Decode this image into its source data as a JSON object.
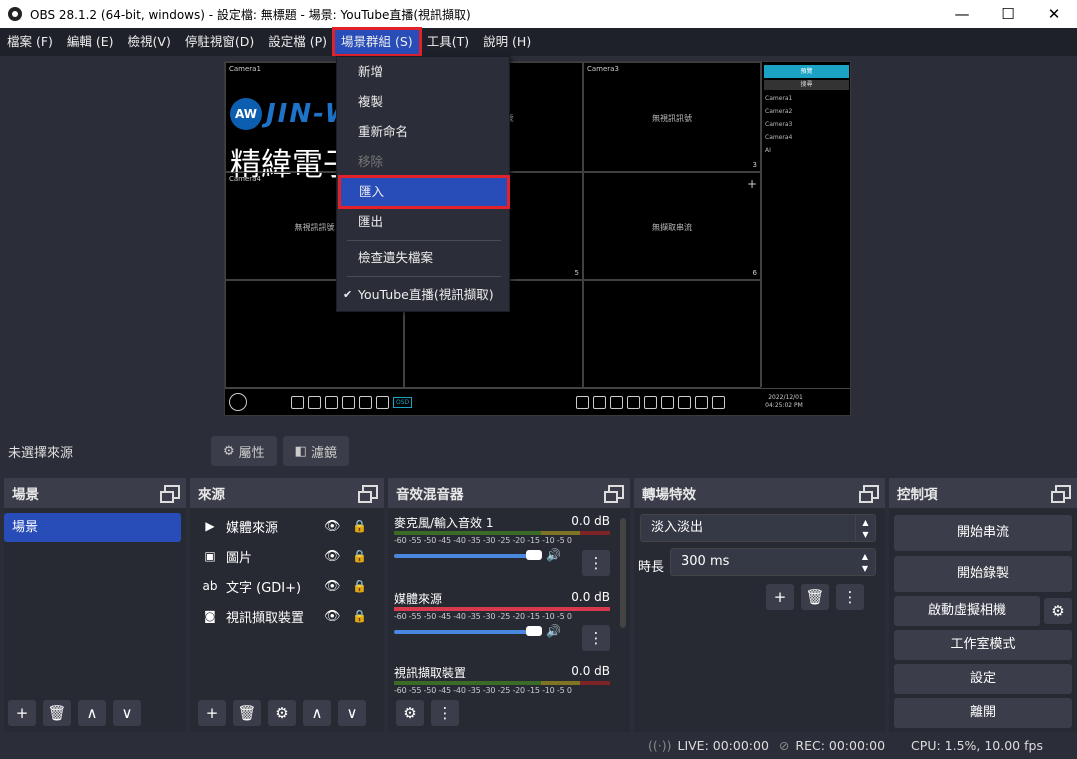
{
  "window": {
    "title": "OBS 28.1.2 (64-bit, windows) - 設定檔: 無標題 - 場景: YouTube直播(視訊擷取)",
    "min": "—",
    "max": "☐",
    "close": "✕"
  },
  "menubar": [
    "檔案 (F)",
    "編輯 (E)",
    "檢視(V)",
    "停駐視窗(D)",
    "設定檔 (P)",
    "場景群組 (S)",
    "工具(T)",
    "說明 (H)"
  ],
  "dropdown": {
    "items": [
      "新增",
      "複製",
      "重新命名",
      "移除",
      "匯入",
      "匯出",
      "檢查遺失檔案",
      "YouTube直播(視訊擷取)"
    ],
    "check": "✔"
  },
  "preview": {
    "cams": [
      "Camera1",
      "Camera2",
      "Camera3",
      "Camera4"
    ],
    "mid_texts": [
      "無視訊訊號",
      "無視訊訊號",
      "無視訊訊號",
      "無擷取串流"
    ],
    "brand_aw": "AW",
    "brand_en": "JIN-W",
    "brand_zh": "精緯電子",
    "side_tab1": "預覽",
    "side_tab2": "搜尋",
    "side_items": [
      "Camera1",
      "Camera2",
      "Camera3",
      "Camera4",
      "AI"
    ],
    "datetime1": "2022/12/01",
    "datetime2": "04:25:02 PM",
    "osd": "OSD",
    "nums": [
      "1",
      "2",
      "3",
      "4",
      "5",
      "6"
    ]
  },
  "srcbar": {
    "no_selection": "未選擇來源",
    "props": "屬性",
    "filters": "濾鏡"
  },
  "docks": {
    "scenes": {
      "title": "場景",
      "items": [
        "場景"
      ]
    },
    "sources": {
      "title": "來源",
      "items": [
        {
          "icon": "play-icon",
          "label": "媒體來源"
        },
        {
          "icon": "image-icon",
          "label": "圖片"
        },
        {
          "icon": "text-icon",
          "label": "文字 (GDI+)"
        },
        {
          "icon": "camera-icon",
          "label": "視訊擷取裝置"
        }
      ]
    },
    "mixer": {
      "title": "音效混音器",
      "channels": [
        {
          "name": "麥克風/輸入音效 1",
          "db": "0.0 dB"
        },
        {
          "name": "媒體來源",
          "db": "0.0 dB"
        },
        {
          "name": "視訊擷取裝置",
          "db": "0.0 dB"
        }
      ],
      "scale": "-60 -55 -50 -45 -40 -35 -30 -25 -20 -15 -10 -5 0"
    },
    "transitions": {
      "title": "轉場特效",
      "selected": "淡入淡出",
      "duration_label": "時長",
      "duration": "300 ms"
    },
    "controls": {
      "title": "控制項",
      "buttons": [
        "開始串流",
        "開始錄製",
        "啟動虛擬相機",
        "工作室模式",
        "設定",
        "離開"
      ]
    }
  },
  "status": {
    "live": "LIVE: 00:00:00",
    "rec": "REC: 00:00:00",
    "cpu": "CPU: 1.5%, 10.00 fps"
  },
  "colors": {
    "accent": "#284cb8",
    "highlight_border": "#e3212b",
    "bg": "#2b2e38"
  }
}
